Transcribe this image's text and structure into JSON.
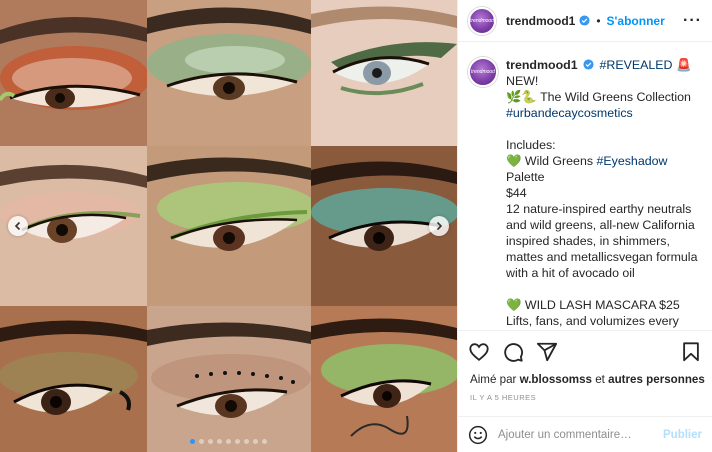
{
  "header": {
    "username": "trendmood1",
    "separator": "•",
    "follow_label": "S'abonner",
    "more_label": "···",
    "avatar_text": "trendmood"
  },
  "caption": {
    "username": "trendmood1",
    "line1_hashtag": "#REVEALED",
    "line1_emoji": "🚨",
    "line1_rest": " NEW!",
    "line2": "🌿🐍 The Wild Greens Collection",
    "brand_tag": "#urbandecaycosmetics",
    "includes": "Includes:",
    "item1_prefix": "💚 Wild Greens ",
    "item1_tag": "#Eyeshadow",
    "item1_suffix": " Palette",
    "item1_price": "$44",
    "item1_desc": "12 nature-inspired earthy neutrals and wild greens, all-new California inspired shades, in shimmers, mattes and metallicsvegan formula with a hit of avocado oil",
    "item2_title": "💚 WILD LASH MASCARA $25",
    "item2_desc": "Lifts, fans, and volumizes every lash from root to tip, Quick-drying vegan formula, Smudge, transfer and flake resistant and can be removed gently and easily. Up to 16 hours with cassava"
  },
  "likes": {
    "prefix": "Aimé par ",
    "user": "w.blossomss",
    "mid": " et ",
    "others": "autres personnes"
  },
  "timestamp": "IL Y A 5 HEURES",
  "comment": {
    "placeholder": "Ajouter un commentaire…",
    "publish_label": "Publier"
  },
  "carousel": {
    "dot_count": 9,
    "active_index": 0
  },
  "colors": {
    "accent": "#0095f6",
    "link": "#00376b",
    "verified": "#3897f0",
    "publish_disabled": "#b2dffc",
    "active_dot": "#2a96f7"
  },
  "icons": {
    "prev": "chevron-left-icon",
    "next": "chevron-right-icon",
    "like": "heart-icon",
    "comment": "comment-icon",
    "share": "paper-plane-icon",
    "save": "bookmark-icon",
    "emoji": "smiley-icon",
    "verified": "verified-badge-icon"
  }
}
